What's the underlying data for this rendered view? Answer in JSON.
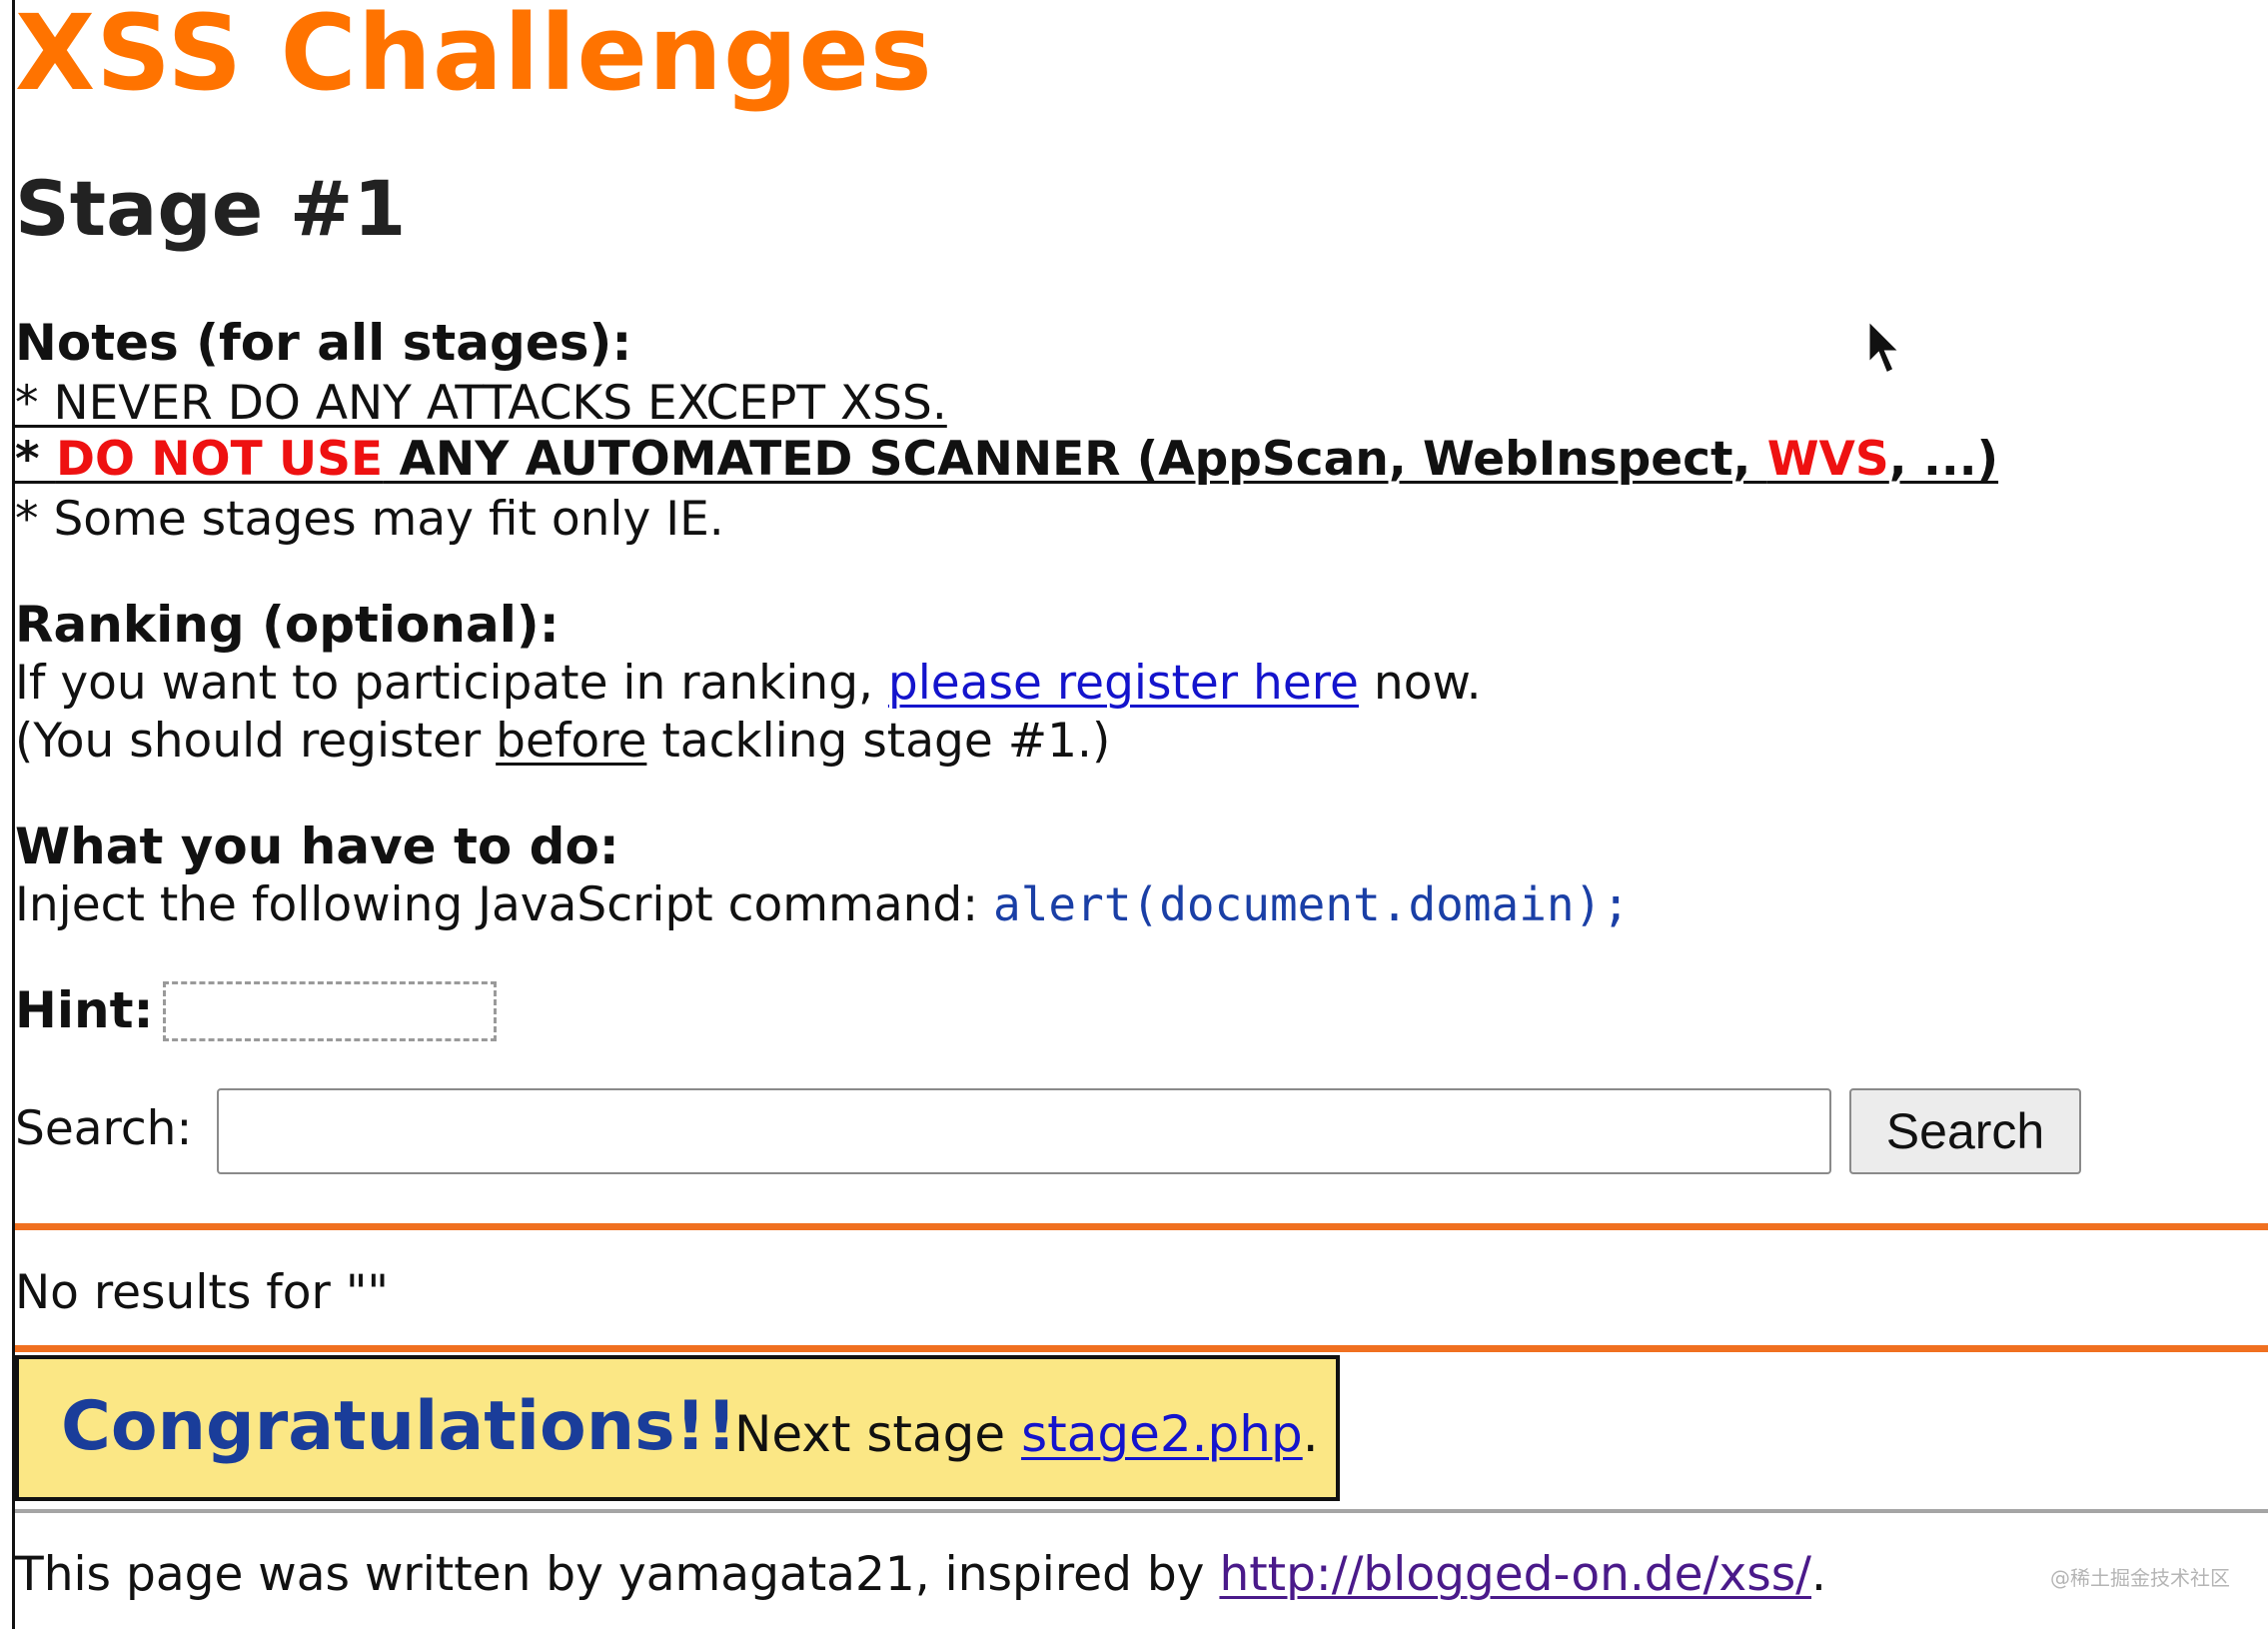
{
  "header": {
    "site_title": "XSS Challenges",
    "stage_title": "Stage #1"
  },
  "notes": {
    "heading": "Notes (for all stages):",
    "line1": "* NEVER DO ANY ATTACKS EXCEPT XSS.",
    "line2_prefix": "* ",
    "line2_red": "DO NOT USE",
    "line2_middle": " ANY AUTOMATED SCANNER (AppScan, WebInspect, ",
    "line2_red2": "WVS",
    "line2_suffix": ", ...)",
    "line3": "* Some stages may fit only IE."
  },
  "ranking": {
    "heading": "Ranking (optional):",
    "line1_prefix": "If you want to participate in ranking, ",
    "register_link": "please register here",
    "line1_suffix": " now.",
    "line2_prefix": "(You should register ",
    "line2_underlined": "before",
    "line2_suffix": " tackling stage #1.)"
  },
  "task": {
    "heading": "What you have to do:",
    "line_prefix": "Inject the following JavaScript command: ",
    "command": "alert(document.domain);"
  },
  "hint": {
    "label": "Hint:"
  },
  "search": {
    "label": "Search:",
    "value": "",
    "button_label": "Search"
  },
  "result": {
    "text": "No results for \"\""
  },
  "congrats": {
    "title": "Congratulations!!",
    "next_prefix": "Next stage ",
    "next_link": "stage2.php",
    "next_suffix": "."
  },
  "footer": {
    "prefix": "This page was written by yamagata21, inspired by ",
    "link": "http://blogged-on.de/xss/",
    "suffix": "."
  },
  "watermark": "@稀土掘金技术社区",
  "colors": {
    "title_orange": "#ff7300",
    "rule_orange": "#f07020",
    "warning_red": "#ee1111",
    "link_blue": "#1414cc",
    "code_blue": "#1a3fa6",
    "congrats_bg": "#fbe785",
    "congrats_title": "#1a3d9a"
  }
}
